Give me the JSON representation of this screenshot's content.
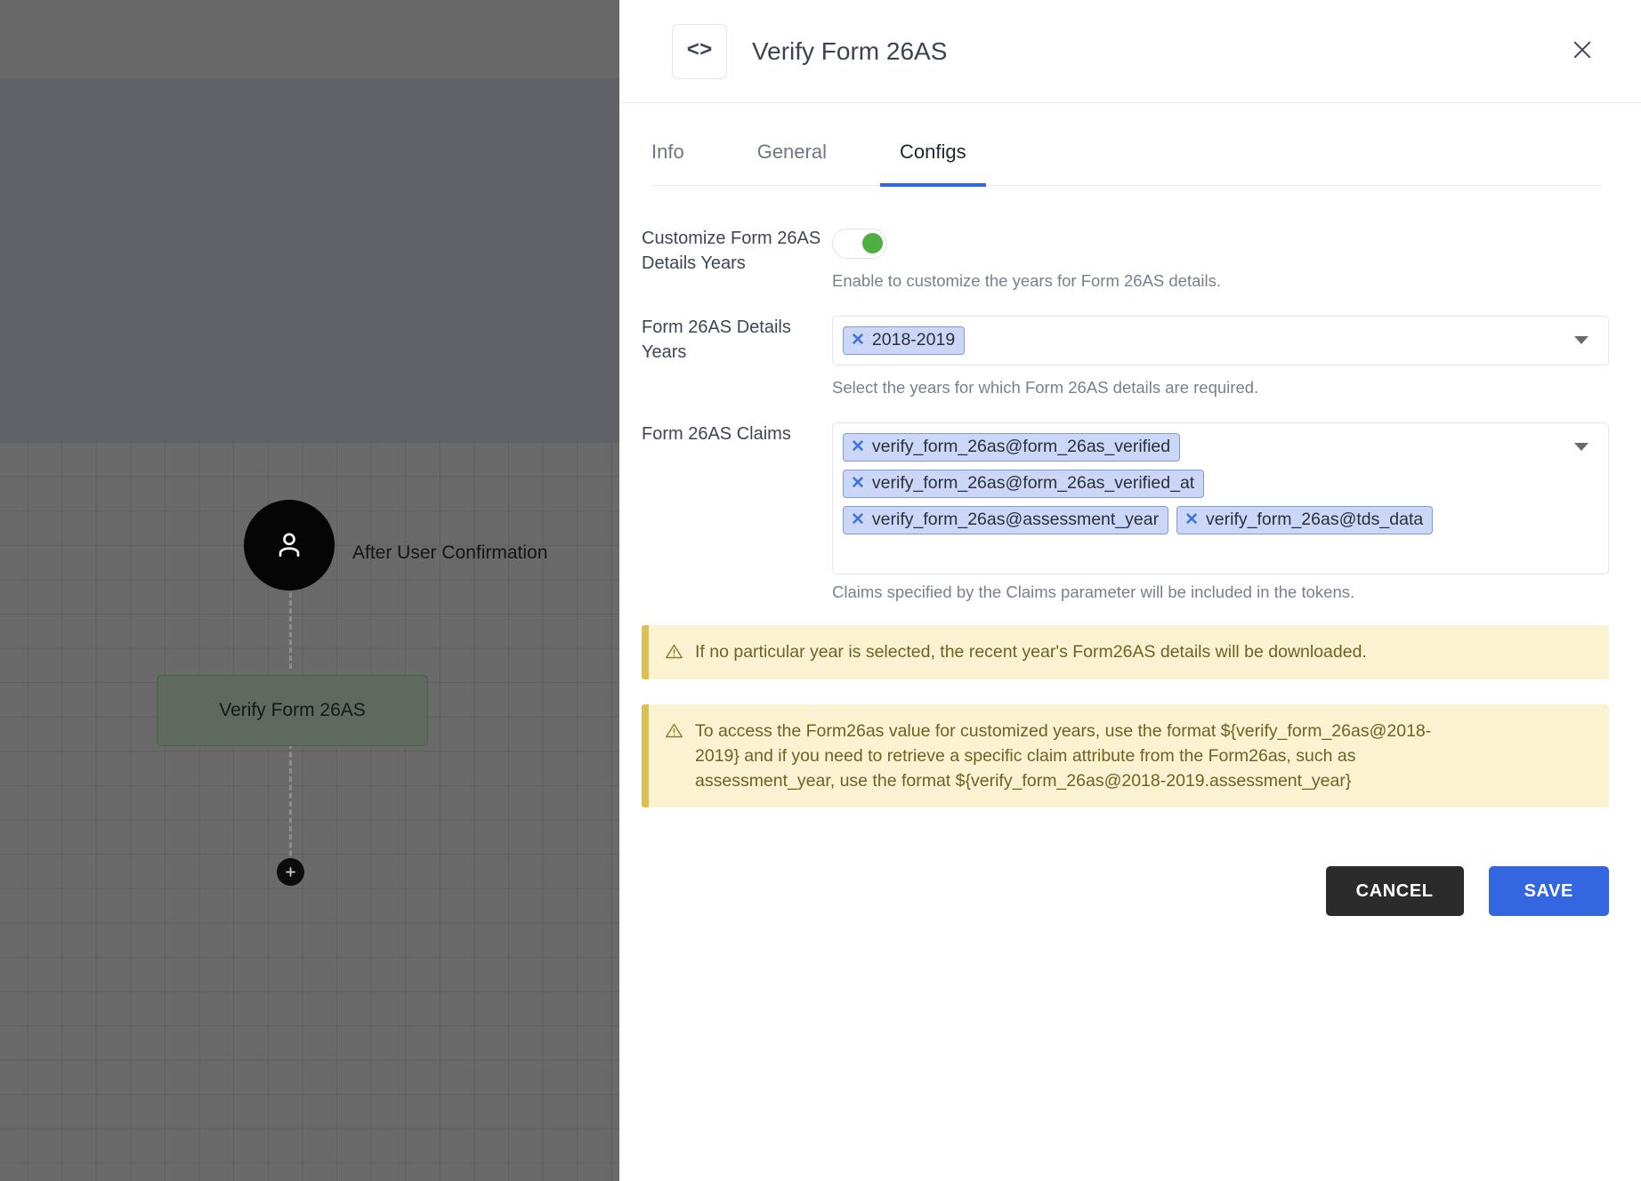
{
  "canvas": {
    "user_node": {
      "label": "After User Confirmation",
      "icon": "user-icon"
    },
    "action_node": {
      "label": "Verify Form 26AS"
    },
    "add_button": {
      "icon": "plus-icon",
      "label": "+"
    }
  },
  "panel": {
    "icon": "code-icon",
    "icon_glyph": "<>",
    "title": "Verify Form 26AS",
    "close_icon": "close-icon",
    "tabs": [
      {
        "label": "Info",
        "active": false
      },
      {
        "label": "General",
        "active": false
      },
      {
        "label": "Configs",
        "active": true
      }
    ],
    "fields": {
      "customize_years": {
        "label": "Customize Form 26AS Details Years",
        "toggle_on": true,
        "hint": "Enable to customize the years for Form 26AS details."
      },
      "details_years": {
        "label": "Form 26AS Details Years",
        "chips": [
          "2018-2019"
        ],
        "hint": "Select the years for which Form 26AS details are required.",
        "caret_icon": "chevron-down-icon"
      },
      "claims": {
        "label": "Form 26AS Claims",
        "chips": [
          "verify_form_26as@form_26as_verified",
          "verify_form_26as@form_26as_verified_at",
          "verify_form_26as@assessment_year",
          "verify_form_26as@tds_data"
        ],
        "hint": "Claims specified by the Claims parameter will be included in the tokens.",
        "caret_icon": "chevron-down-icon"
      }
    },
    "notes": [
      {
        "icon": "warning-icon",
        "text": "If no particular year is selected, the recent year's Form26AS details will be downloaded."
      },
      {
        "icon": "warning-icon",
        "text": "To access the Form26as value for customized years, use the format ${verify_form_26as@2018-2019} and if you need to retrieve a specific claim attribute from the Form26as, such as assessment_year, use the format ${verify_form_26as@2018-2019.assessment_year}"
      }
    ],
    "buttons": {
      "cancel": "CANCEL",
      "save": "SAVE"
    }
  },
  "colors": {
    "accent": "#3366e0",
    "toggle_on": "#4caf3f",
    "chip_bg": "#ccd7f7",
    "note_bg": "#faf2d0",
    "note_border": "#d9c154",
    "cancel_bg": "#2b2b2b"
  }
}
